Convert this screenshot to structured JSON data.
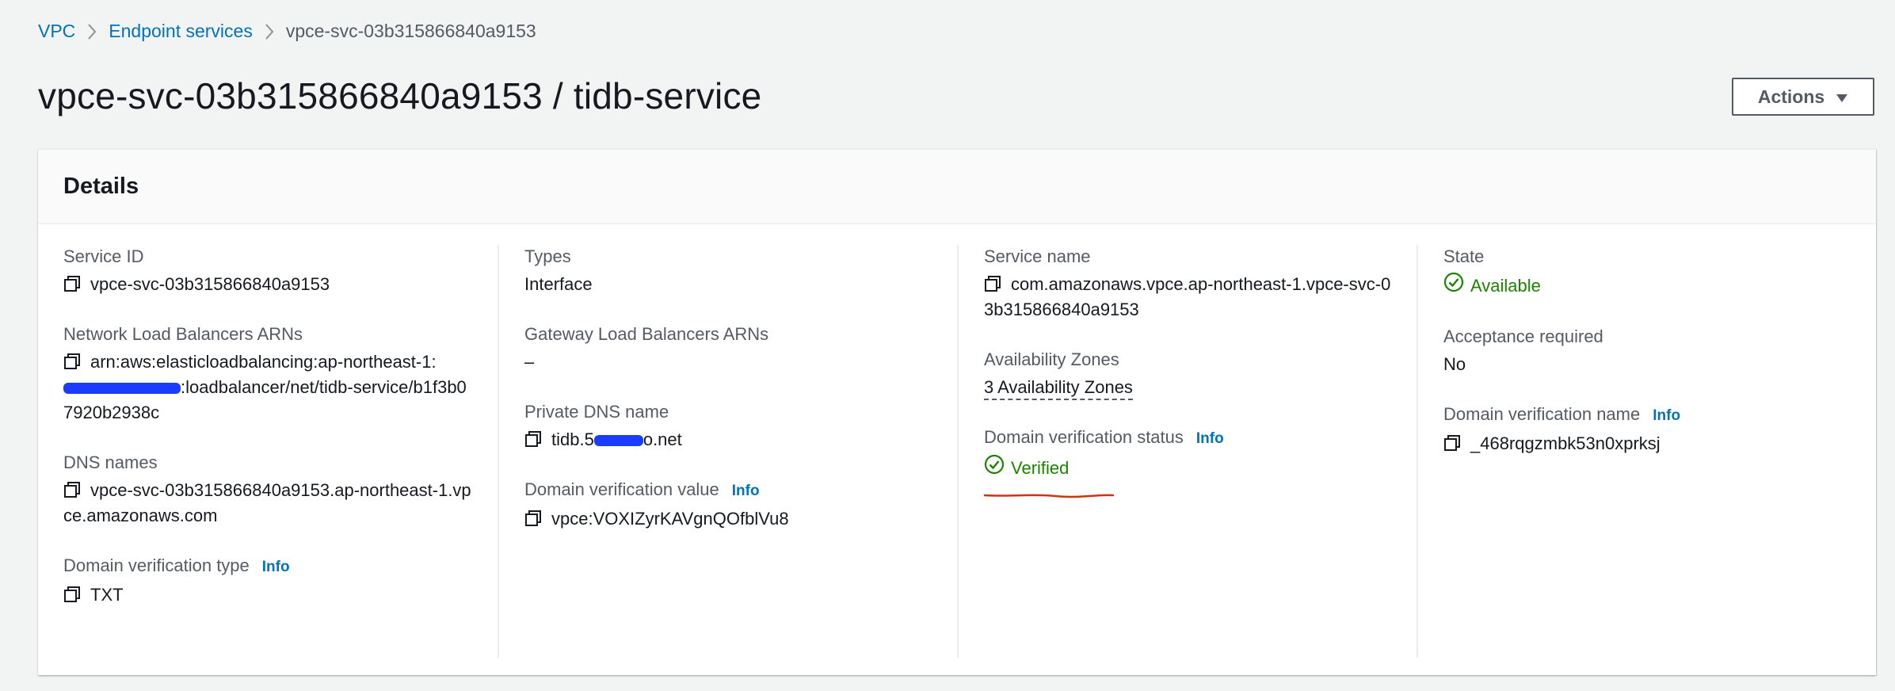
{
  "breadcrumb": {
    "items": [
      "VPC",
      "Endpoint services",
      "vpce-svc-03b315866840a9153"
    ]
  },
  "page": {
    "title": "vpce-svc-03b315866840a9153 / tidb-service",
    "actions_label": "Actions"
  },
  "details": {
    "heading": "Details",
    "info_label": "Info",
    "col1": {
      "service_id_label": "Service ID",
      "service_id_value": "vpce-svc-03b315866840a9153",
      "nlb_label": "Network Load Balancers ARNs",
      "nlb_value_prefix": "arn:aws:elasticloadbalancing:ap-northeast-1:",
      "nlb_value_suffix": ":loadbalancer/net/tidb-service/b1f3b07920b2938c",
      "dns_label": "DNS names",
      "dns_value": "vpce-svc-03b315866840a9153.ap-northeast-1.vpce.amazonaws.com",
      "dvt_label": "Domain verification type",
      "dvt_value": "TXT"
    },
    "col2": {
      "types_label": "Types",
      "types_value": "Interface",
      "glb_label": "Gateway Load Balancers ARNs",
      "glb_value": "–",
      "pdns_label": "Private DNS name",
      "pdns_value_prefix": "tidb.5",
      "pdns_value_suffix": "o.net",
      "dvv_label": "Domain verification value",
      "dvv_value": "vpce:VOXIZyrKAVgnQOfblVu8"
    },
    "col3": {
      "sname_label": "Service name",
      "sname_value": "com.amazonaws.vpce.ap-northeast-1.vpce-svc-03b315866840a9153",
      "az_label": "Availability Zones",
      "az_value": "3 Availability Zones",
      "dvs_label": "Domain verification status",
      "dvs_value": "Verified"
    },
    "col4": {
      "state_label": "State",
      "state_value": "Available",
      "accept_label": "Acceptance required",
      "accept_value": "No",
      "dvn_label": "Domain verification name",
      "dvn_value": "_468rqgzmbk53n0xprksj"
    }
  },
  "colors": {
    "link": "#0073bb",
    "success": "#1d8102",
    "redaction": "#1a3cff",
    "annotation": "#d13212"
  }
}
